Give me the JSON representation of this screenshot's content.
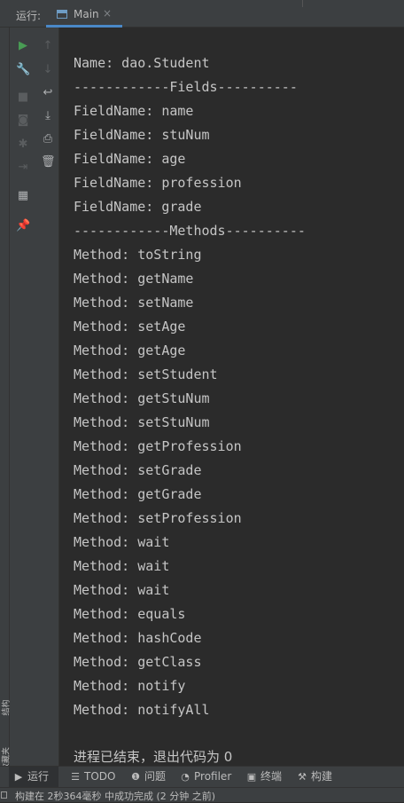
{
  "titlebar": {
    "run_label": "运行:",
    "tab_label": "Main",
    "tab_close": "×"
  },
  "toolbar_left": [
    {
      "name": "run-icon",
      "glyph": "▶",
      "color": "#499c54",
      "enabled": true
    },
    {
      "name": "wrench-icon",
      "glyph": "🔧",
      "color": "#afb1b3",
      "enabled": true
    },
    {
      "name": "stop-icon",
      "glyph": "■",
      "color": "#5a5d5f",
      "enabled": false
    },
    {
      "name": "camera-icon",
      "glyph": "◙",
      "color": "#5a5d5f",
      "enabled": false
    },
    {
      "name": "bug-icon",
      "glyph": "✱",
      "color": "#5a5d5f",
      "enabled": false
    },
    {
      "name": "exit-icon",
      "glyph": "⇥",
      "color": "#5a5d5f",
      "enabled": false
    },
    {
      "name": "layout-icon",
      "glyph": "▦",
      "color": "#afb1b3",
      "enabled": true
    },
    {
      "name": "pin-icon",
      "glyph": "📌",
      "color": "#afb1b3",
      "enabled": true
    }
  ],
  "toolbar_right": [
    {
      "name": "up-arrow-icon",
      "glyph": "↑",
      "color": "#5a5d5f",
      "enabled": false
    },
    {
      "name": "down-arrow-icon",
      "glyph": "↓",
      "color": "#5a5d5f",
      "enabled": false
    },
    {
      "name": "soft-wrap-icon",
      "glyph": "↩",
      "color": "#afb1b3",
      "enabled": true
    },
    {
      "name": "scroll-to-end-icon",
      "glyph": "⤓",
      "color": "#afb1b3",
      "enabled": true
    },
    {
      "name": "print-icon",
      "glyph": "⎙",
      "color": "#afb1b3",
      "enabled": true
    },
    {
      "name": "trash-icon",
      "glyph": "🗑",
      "color": "#afb1b3",
      "enabled": true
    }
  ],
  "console": {
    "lines": [
      "Name: dao.Student",
      "------------Fields----------",
      "FieldName: name",
      "FieldName: stuNum",
      "FieldName: age",
      "FieldName: profession",
      "FieldName: grade",
      "------------Methods----------",
      "Method: toString",
      "Method: getName",
      "Method: setName",
      "Method: setAge",
      "Method: getAge",
      "Method: setStudent",
      "Method: getStuNum",
      "Method: setStuNum",
      "Method: getProfession",
      "Method: setGrade",
      "Method: getGrade",
      "Method: setProfession",
      "Method: wait",
      "Method: wait",
      "Method: wait",
      "Method: equals",
      "Method: hashCode",
      "Method: getClass",
      "Method: notify",
      "Method: notifyAll"
    ],
    "finish_line": "进程已结束，退出代码为 0"
  },
  "side_labels": {
    "structure": "结构",
    "favorites": "收藏夹"
  },
  "toolwindows": [
    {
      "name": "run",
      "icon": "run-icon",
      "glyph": "▶",
      "label": "运行"
    },
    {
      "name": "todo",
      "icon": "list-icon",
      "glyph": "☰",
      "label": "TODO"
    },
    {
      "name": "problems",
      "icon": "problem-icon",
      "glyph": "❶",
      "label": "问题"
    },
    {
      "name": "profiler",
      "icon": "profiler-icon",
      "glyph": "◔",
      "label": "Profiler"
    },
    {
      "name": "terminal",
      "icon": "terminal-icon",
      "glyph": "▣",
      "label": "终端"
    },
    {
      "name": "build",
      "icon": "hammer-icon",
      "glyph": "⚒",
      "label": "构建"
    }
  ],
  "status": {
    "text": "构建在 2秒364毫秒 中成功完成 (2 分钟 之前)"
  }
}
